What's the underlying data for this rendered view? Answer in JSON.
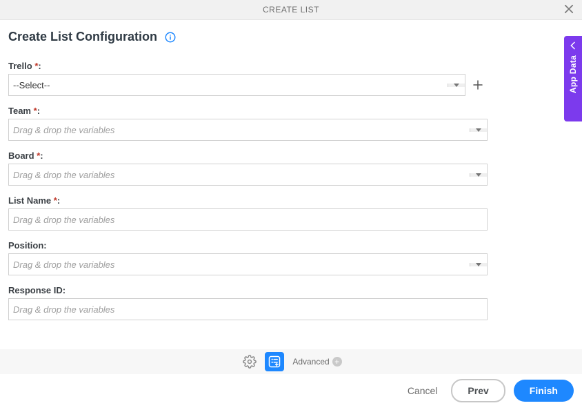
{
  "header": {
    "title": "CREATE LIST"
  },
  "page_title": "Create List Configuration",
  "side_tab_label": "App Data",
  "fields": {
    "trello": {
      "label": "Trello",
      "required": true,
      "value": "--Select--",
      "has_add": true,
      "has_dropdown": true
    },
    "team": {
      "label": "Team",
      "required": true,
      "placeholder": "Drag & drop the variables",
      "has_dropdown": true
    },
    "board": {
      "label": "Board",
      "required": true,
      "placeholder": "Drag & drop the variables",
      "has_dropdown": true
    },
    "list_name": {
      "label": "List Name",
      "required": true,
      "placeholder": "Drag & drop the variables",
      "has_dropdown": false
    },
    "position": {
      "label": "Position",
      "required": false,
      "placeholder": "Drag & drop the variables",
      "has_dropdown": true
    },
    "response_id": {
      "label": "Response ID",
      "required": false,
      "placeholder": "Drag & drop the variables",
      "has_dropdown": false
    }
  },
  "toolbar": {
    "advanced_label": "Advanced"
  },
  "buttons": {
    "cancel": "Cancel",
    "prev": "Prev",
    "finish": "Finish"
  }
}
